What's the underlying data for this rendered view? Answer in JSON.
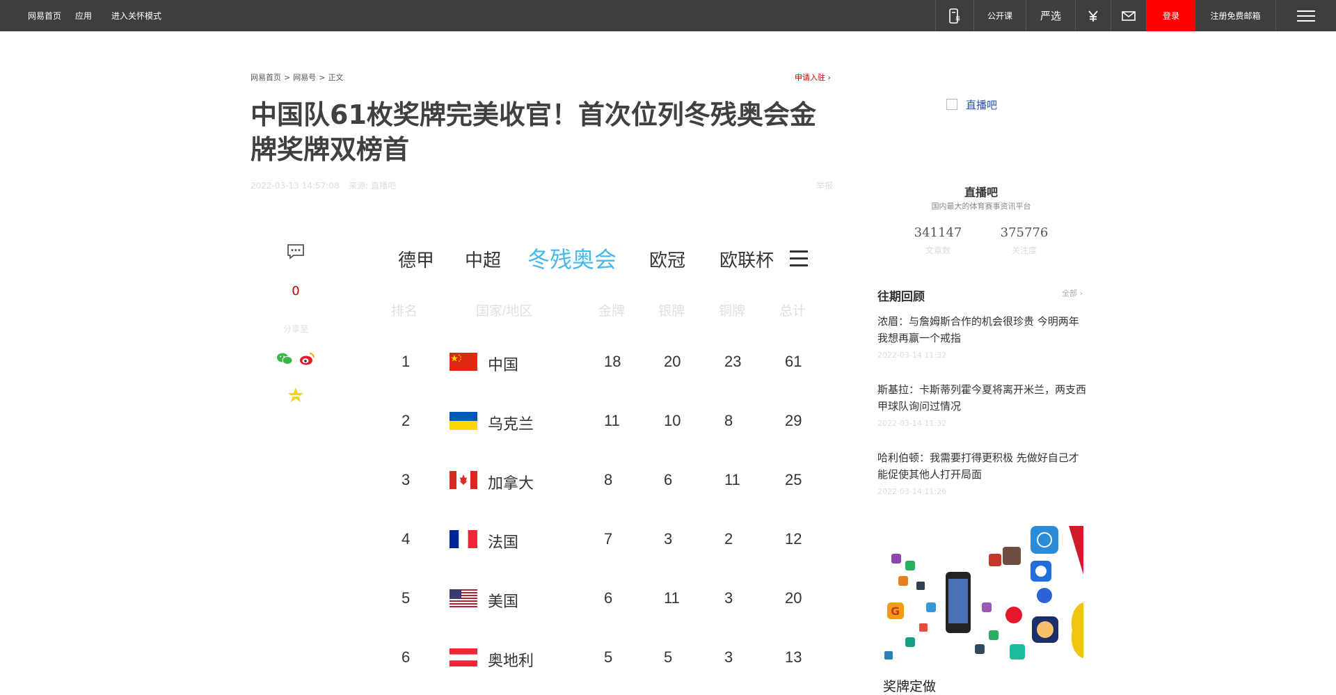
{
  "topbar": {
    "links": [
      "网易首页",
      "应用",
      "进入关怀模式"
    ],
    "right": {
      "open_course": "公开课",
      "yanxuan": "严选",
      "login": "登录",
      "register": "注册免费邮箱"
    },
    "icons": [
      "phone-news-icon",
      "yanxuan-logo-icon",
      "yen-icon",
      "mail-icon",
      "hamburger-menu-icon"
    ]
  },
  "breadcrumb": [
    "网易首页",
    ">",
    "网易号",
    ">",
    "正文"
  ],
  "apply_link": "申请入驻 ›",
  "article": {
    "title": "中国队61枚奖牌完美收官！首次位列冬残奥会金牌奖牌双榜首",
    "date": "2022-03-13 14:57:08",
    "source": "来源: 直播吧",
    "report": "举报"
  },
  "share": {
    "comment_count": "0",
    "share_label": "分享至",
    "icons": [
      "comment-icon",
      "wechat-icon",
      "weibo-icon",
      "qzone-icon"
    ]
  },
  "medal_embed": {
    "tabs": [
      "德甲",
      "中超",
      "冬残奥会",
      "欧冠",
      "欧联杯"
    ],
    "active_tab": "冬残奥会",
    "headers": [
      "排名",
      "国家/地区",
      "金牌",
      "银牌",
      "铜牌",
      "总计"
    ],
    "rows": [
      {
        "rank": "1",
        "country": "中国",
        "flag": "china",
        "gold": "18",
        "silver": "20",
        "bronze": "23",
        "total": "61"
      },
      {
        "rank": "2",
        "country": "乌克兰",
        "flag": "ukraine",
        "gold": "11",
        "silver": "10",
        "bronze": "8",
        "total": "29"
      },
      {
        "rank": "3",
        "country": "加拿大",
        "flag": "canada",
        "gold": "8",
        "silver": "6",
        "bronze": "11",
        "total": "25"
      },
      {
        "rank": "4",
        "country": "法国",
        "flag": "france",
        "gold": "7",
        "silver": "3",
        "bronze": "2",
        "total": "12"
      },
      {
        "rank": "5",
        "country": "美国",
        "flag": "usa",
        "gold": "6",
        "silver": "11",
        "bronze": "3",
        "total": "20"
      },
      {
        "rank": "6",
        "country": "奥地利",
        "flag": "austria",
        "gold": "5",
        "silver": "5",
        "bronze": "3",
        "total": "13"
      }
    ]
  },
  "sidebar": {
    "logo_alt": "直播吧",
    "name": "直播吧",
    "desc": "国内最大的体育赛事资讯平台",
    "stats": [
      {
        "num": "341147",
        "label": "文章数"
      },
      {
        "num": "375776",
        "label": "关注度"
      }
    ],
    "past_title": "往期回顾",
    "all_link": "全部 ›",
    "news": [
      {
        "title": "浓眉：与詹姆斯合作的机会很珍贵 今明两年我想再赢一个戒指",
        "date": "2022-03-14 11:32"
      },
      {
        "title": "斯基拉：卡斯蒂列霍今夏将离开米兰，两支西甲球队询问过情况",
        "date": "2022-03-14 11:32"
      },
      {
        "title": "哈利伯顿：我需要打得更积极 先做好自己才能促使其他人打开局面",
        "date": "2022-03-14 11:26"
      }
    ],
    "ad_caption": "奖牌定做"
  },
  "colors": {
    "topbar_bg": "#3e3e3e",
    "login_bg": "#ff0000",
    "active_tab": "#48b8e8",
    "comment_count": "#cc0000"
  }
}
